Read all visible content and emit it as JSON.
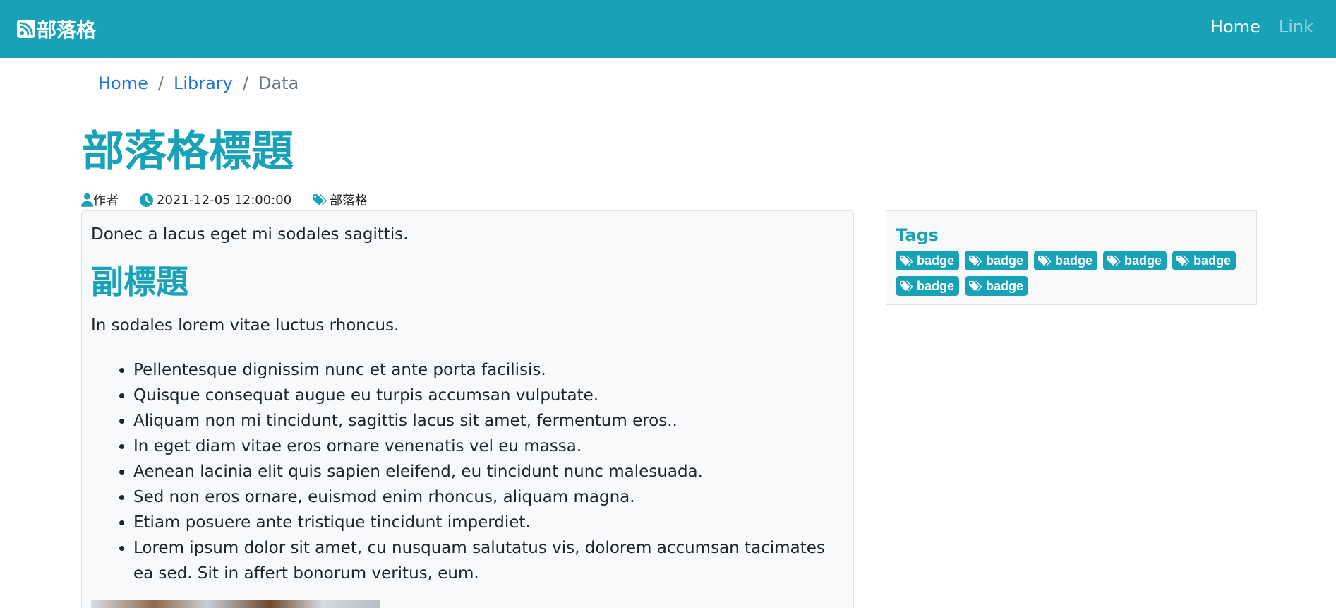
{
  "navbar": {
    "brand": "部落格",
    "links": [
      {
        "label": "Home"
      },
      {
        "label": "Link"
      }
    ]
  },
  "breadcrumb": {
    "items": [
      "Home",
      "Library",
      "Data"
    ],
    "separator": "/"
  },
  "post": {
    "title": "部落格標題",
    "author": "作者",
    "datetime": "2021-12-05 12:00:00",
    "category": "部落格",
    "lead": "Donec a lacus eget mi sodales sagittis.",
    "subtitle": "副標題",
    "paragraph": "In sodales lorem vitae luctus rhoncus.",
    "list": [
      "Pellentesque dignissim nunc et ante porta facilisis.",
      "Quisque consequat augue eu turpis accumsan vulputate.",
      "Aliquam non mi tincidunt, sagittis lacus sit amet, fermentum eros..",
      "In eget diam vitae eros ornare venenatis vel eu massa.",
      "Aenean lacinia elit quis sapien eleifend, eu tincidunt nunc malesuada.",
      "Sed non eros ornare, euismod enim rhoncus, aliquam magna.",
      "Etiam posuere ante tristique tincidunt imperdiet.",
      "Lorem ipsum dolor sit amet, cu nusquam salutatus vis, dolorem accumsan tacimates ea sed. Sit in affert bonorum veritus, eum."
    ]
  },
  "sidebar": {
    "title": "Tags",
    "badges": [
      "badge",
      "badge",
      "badge",
      "badge",
      "badge",
      "badge",
      "badge"
    ]
  },
  "colors": {
    "primary": "#17a2b8",
    "link": "#1f75d6",
    "muted": "#6c757d",
    "panel": "#f8f9fa"
  },
  "icons": {
    "brand": "rss-square-icon",
    "author": "user-icon",
    "time": "clock-icon",
    "category": "tags-icon",
    "badge": "tags-icon"
  }
}
